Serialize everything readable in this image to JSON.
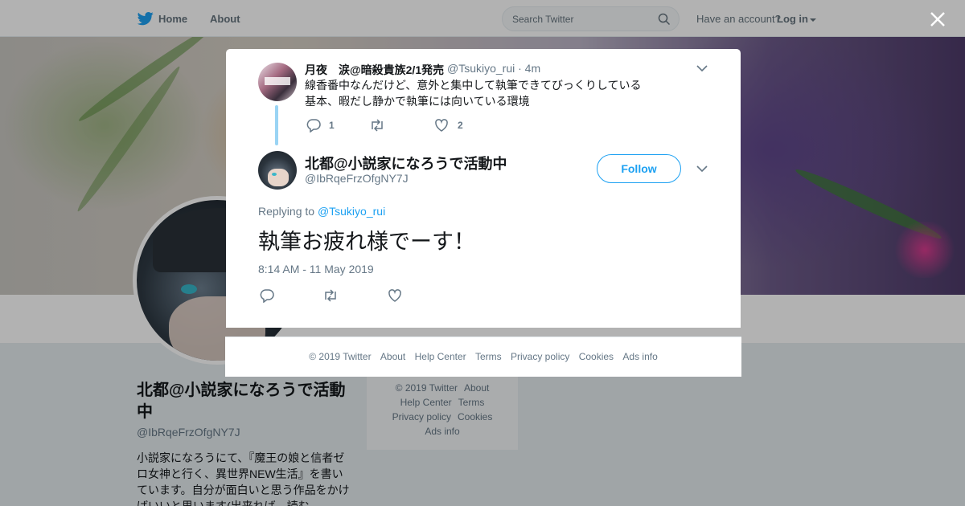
{
  "nav": {
    "home_label": "Home",
    "about_label": "About",
    "search_placeholder": "Search Twitter",
    "have_account": "Have an account?",
    "login_label": "Log in"
  },
  "profile": {
    "name": "北都@小説家になろうで活動中",
    "handle": "@IbRqeFrzOfgNY7J",
    "bio": "小説家になろうにて、『魔王の娘と信者ゼロ女神と行く、異世界NEW生活』を書いています。自分が面白いと思う作品をかけばいいと思います(出来れば、読む"
  },
  "side_footer": {
    "links": [
      "© 2019 Twitter",
      "About",
      "Help Center",
      "Terms",
      "Privacy policy",
      "Cookies",
      "Ads info"
    ]
  },
  "modal": {
    "parent_tweet": {
      "name": "月夜　涙@暗殺貴族2/1発売",
      "handle": "@Tsukiyo_rui · 4m",
      "text_line1": "線香番中なんだけど、意外と集中して執筆できてびっくりしている",
      "text_line2": "基本、暇だし静かで執筆には向いている環境",
      "reply_count": "1",
      "retweet_count": "",
      "like_count": "2"
    },
    "main_tweet": {
      "name": "北都@小説家になろうで活動中",
      "handle": "@IbRqeFrzOfgNY7J",
      "follow_label": "Follow",
      "replying_prefix": "Replying to ",
      "replying_to": "@Tsukiyo_rui",
      "text": "執筆お疲れ様でーす！",
      "timestamp": "8:14 AM - 11 May 2019"
    },
    "footer_links": [
      "© 2019 Twitter",
      "About",
      "Help Center",
      "Terms",
      "Privacy policy",
      "Cookies",
      "Ads info"
    ]
  },
  "colors": {
    "accent": "#1da1f2",
    "muted": "#657786",
    "thread_line": "#9ad4f4"
  }
}
